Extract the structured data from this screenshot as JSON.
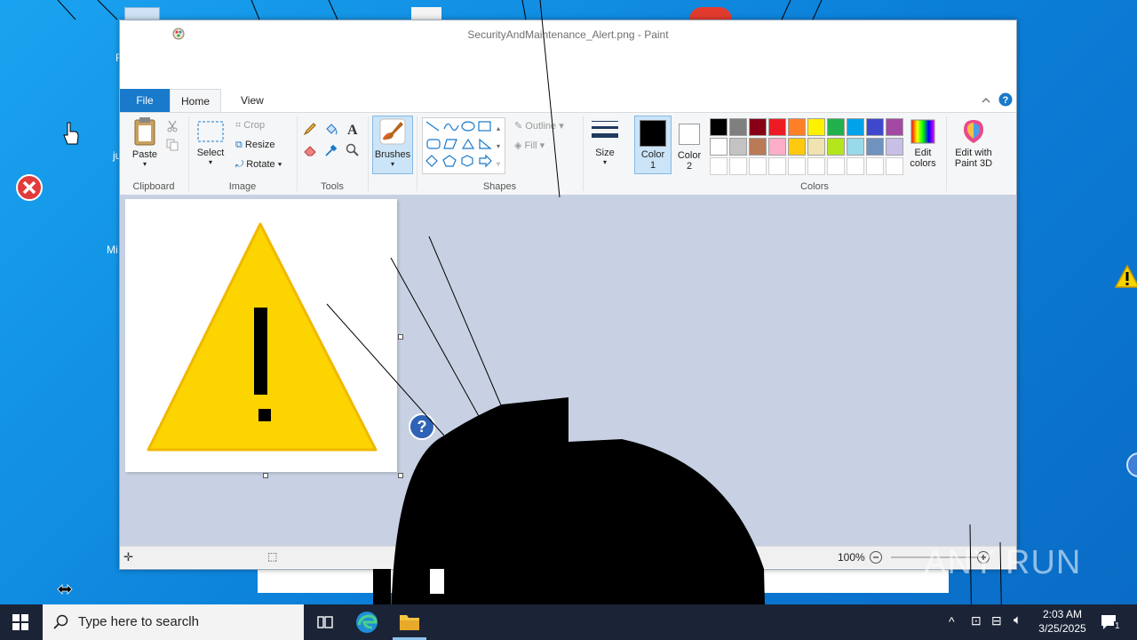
{
  "window": {
    "title": "SecurityAndMaintenance_Alert.png - Paint"
  },
  "tabs": {
    "file": "File",
    "home": "Home",
    "view": "View"
  },
  "ribbon": {
    "clipboard": {
      "paste": "Paste",
      "group": "Clipboard"
    },
    "image": {
      "select": "Select",
      "crop": "Crop",
      "resize": "Resize",
      "rotate": "Rotate",
      "group": "Image"
    },
    "tools": {
      "group": "Tools"
    },
    "brushes": "Brushes",
    "shapes": {
      "outline": "Outline",
      "fill": "Fill",
      "group": "Shapes"
    },
    "size": "Size",
    "color1": {
      "line1": "Color",
      "line2": "1"
    },
    "color2": {
      "line1": "Color",
      "line2": "2"
    },
    "colors": {
      "group": "Colors",
      "edit_line1": "Edit",
      "edit_line2": "colors",
      "row1": [
        "#000000",
        "#7f7f7f",
        "#880015",
        "#ed1c24",
        "#ff7f27",
        "#fff200",
        "#22b14c",
        "#00a2e8",
        "#3f48cc",
        "#a349a4"
      ],
      "row2": [
        "#ffffff",
        "#c3c3c3",
        "#b97a57",
        "#ffaec9",
        "#ffc90e",
        "#efe4b0",
        "#b5e61d",
        "#99d9ea",
        "#7092be",
        "#c8bfe7"
      ]
    },
    "paint3d": {
      "line1": "Edit with",
      "line2": "Paint 3D"
    }
  },
  "status": {
    "zoom": "100%"
  },
  "taskbar": {
    "search_placeholder": "Type here to searclh",
    "time": "2:03 AM",
    "date": "3/25/2025",
    "notification_count": "1"
  },
  "watermark": "ANY RUN",
  "desktop": {
    "label_ju": "ju",
    "label_mi": "Mi",
    "label_r": "R"
  }
}
